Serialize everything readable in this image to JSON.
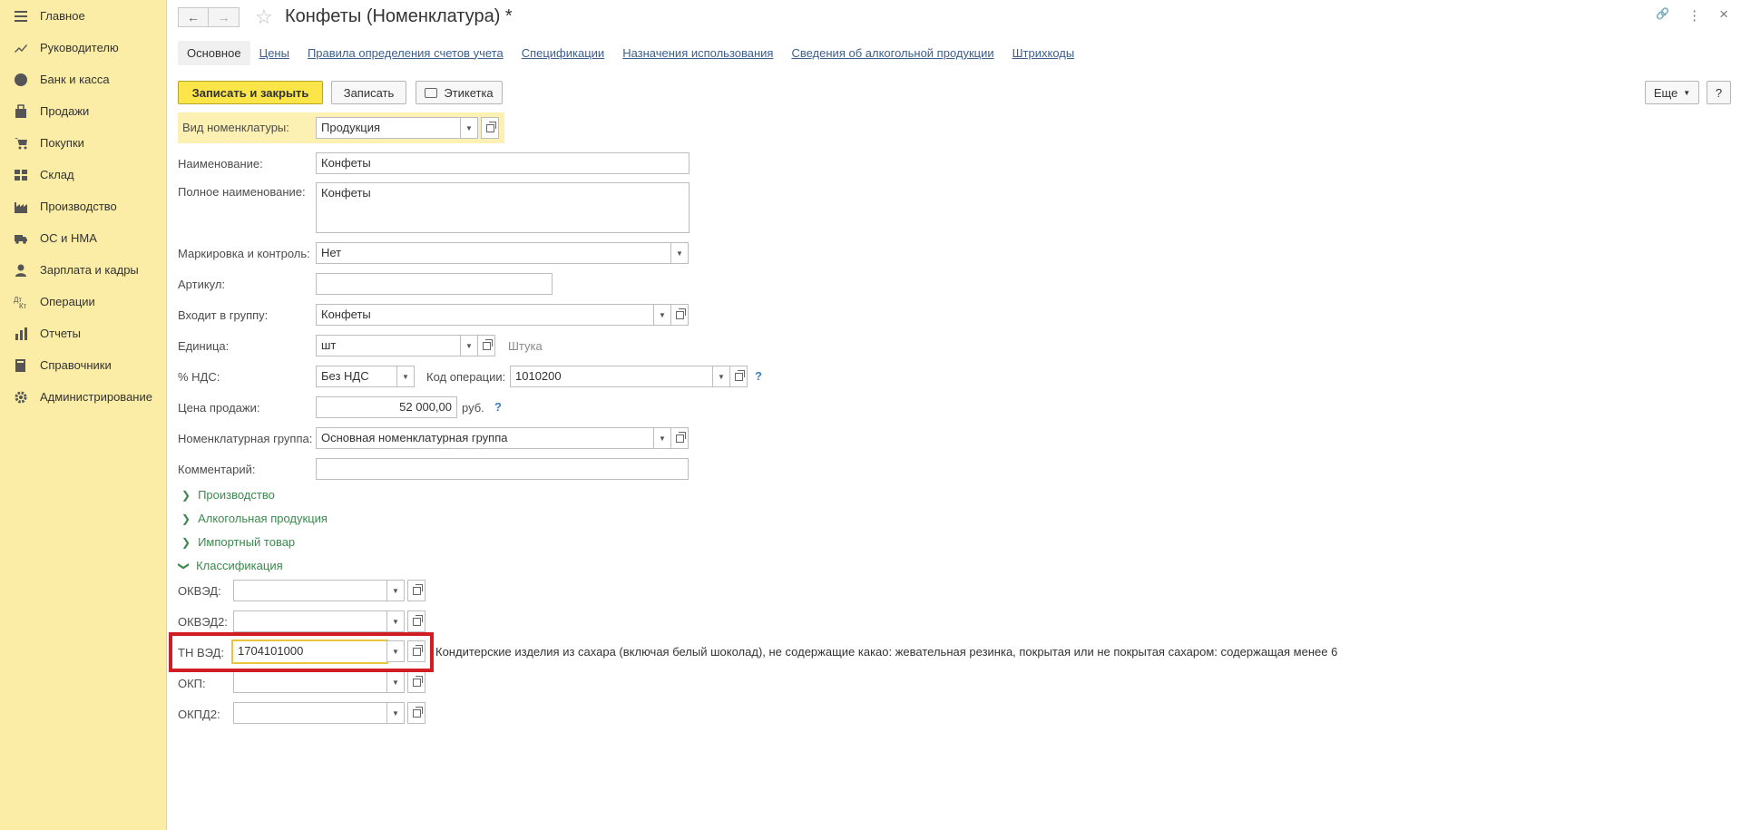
{
  "sidebar": {
    "items": [
      {
        "label": "Главное",
        "icon": "menu-icon"
      },
      {
        "label": "Руководителю",
        "icon": "trend-icon"
      },
      {
        "label": "Банк и касса",
        "icon": "coin-icon"
      },
      {
        "label": "Продажи",
        "icon": "bag-icon"
      },
      {
        "label": "Покупки",
        "icon": "cart-icon"
      },
      {
        "label": "Склад",
        "icon": "warehouse-icon"
      },
      {
        "label": "Производство",
        "icon": "factory-icon"
      },
      {
        "label": "ОС и НМА",
        "icon": "truck-icon"
      },
      {
        "label": "Зарплата и кадры",
        "icon": "person-icon"
      },
      {
        "label": "Операции",
        "icon": "operations-icon"
      },
      {
        "label": "Отчеты",
        "icon": "chart-icon"
      },
      {
        "label": "Справочники",
        "icon": "book-icon"
      },
      {
        "label": "Администрирование",
        "icon": "gear-icon"
      }
    ]
  },
  "header": {
    "title": "Конфеты (Номенклатура) *",
    "back": "←",
    "forward": "→",
    "star": "☆",
    "link": "🔗",
    "more": "⋮",
    "close": "×"
  },
  "tabs": [
    {
      "label": "Основное"
    },
    {
      "label": "Цены"
    },
    {
      "label": "Правила определения счетов учета"
    },
    {
      "label": "Спецификации"
    },
    {
      "label": "Назначения использования"
    },
    {
      "label": "Сведения об алкогольной продукции"
    },
    {
      "label": "Штрихкоды"
    }
  ],
  "toolbar": {
    "save_close": "Записать и закрыть",
    "save": "Записать",
    "label_btn": "Этикетка",
    "more": "Еще",
    "help": "?"
  },
  "form": {
    "vid_label": "Вид номенклатуры:",
    "vid_value": "Продукция",
    "name_label": "Наименование:",
    "name_value": "Конфеты",
    "full_name_label": "Полное наименование:",
    "full_name_value": "Конфеты",
    "marking_label": "Маркировка и контроль:",
    "marking_value": "Нет",
    "article_label": "Артикул:",
    "article_value": "",
    "group_label": "Входит в группу:",
    "group_value": "Конфеты",
    "unit_label": "Единица:",
    "unit_value": "шт",
    "unit_hint": "Штука",
    "vat_label": "% НДС:",
    "vat_value": "Без НДС",
    "op_code_label": "Код операции:",
    "op_code_value": "1010200",
    "op_help": "?",
    "price_label": "Цена продажи:",
    "price_value": "52 000,00",
    "price_currency": "руб.",
    "price_help": "?",
    "nom_group_label": "Номенклатурная группа:",
    "nom_group_value": "Основная номенклатурная группа",
    "comment_label": "Комментарий:",
    "comment_value": ""
  },
  "groups": [
    {
      "label": "Производство",
      "state": "collapsed"
    },
    {
      "label": "Алкогольная продукция",
      "state": "collapsed"
    },
    {
      "label": "Импортный товар",
      "state": "collapsed"
    },
    {
      "label": "Классификация",
      "state": "expanded"
    }
  ],
  "classification": {
    "okved_label": "ОКВЭД:",
    "okved_value": "",
    "okved2_label": "ОКВЭД2:",
    "okved2_value": "",
    "tnved_label": "ТН ВЭД:",
    "tnved_value": "1704101000",
    "tnved_desc": "Кондитерские изделия из сахара (включая белый шоколад), не содержащие какао: жевательная резинка, покрытая или не покрытая сахаром: содержащая менее 6",
    "okp_label": "ОКП:",
    "okp_value": "",
    "okpd2_label": "ОКПД2:",
    "okpd2_value": ""
  },
  "colors": {
    "sidebar_bg": "#fbeda5",
    "primary_button": "#fbe548",
    "link": "#3c5f8c",
    "group_green": "#3a8a4e",
    "highlight_red": "#d21c23"
  }
}
